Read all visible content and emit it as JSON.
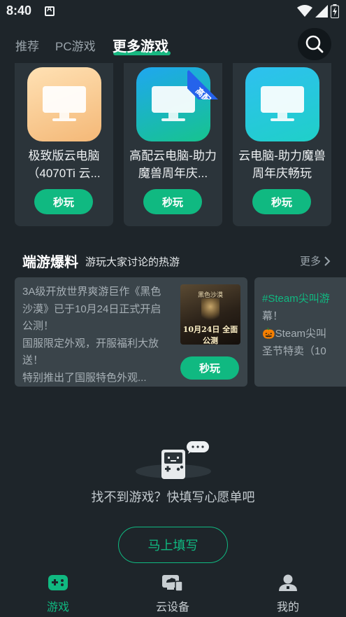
{
  "status_bar": {
    "time": "8:40",
    "icons": [
      "notification-a-icon",
      "wifi-icon",
      "signal-icon",
      "battery-icon"
    ]
  },
  "top_tabs": {
    "items": [
      {
        "label": "推荐",
        "active": false
      },
      {
        "label": "PC游戏",
        "active": false
      },
      {
        "label": "更多游戏",
        "active": true
      }
    ],
    "search_icon": "search-icon"
  },
  "pc_cards": [
    {
      "title": "极致版云电脑（4070Ti 云...",
      "button": "秒玩",
      "icon_color": "#f5c790",
      "badge": ""
    },
    {
      "title": "高配云电脑-助力魔兽周年庆...",
      "button": "秒玩",
      "icon_color": "#16c48e",
      "badge": "高配"
    },
    {
      "title": "云电脑-助力魔兽周年庆畅玩",
      "button": "秒玩",
      "icon_color": "#1fd0c8",
      "badge": ""
    }
  ],
  "section": {
    "title": "端游爆料",
    "subtitle": "游玩大家讨论的热游",
    "more": "更多"
  },
  "news": [
    {
      "text": "3A级开放世界爽游巨作《黑色沙漠》已于10月24日正式开启公测！\n国服限定外观，开服福利大放送！\n特别推出了国服特色外观...",
      "thumb_title": "黑色沙漠",
      "thumb_date": "10月24日 全面公测",
      "button": "秒玩"
    },
    {
      "hashtag": "#Steam尖叫游",
      "text": "幕！\n🎃Steam尖叫\n圣节特卖（10"
    }
  ],
  "wishlist": {
    "message": "找不到游戏？快填写心愿单吧",
    "button": "马上填写"
  },
  "bottom_nav": [
    {
      "label": "游戏",
      "icon": "gamepad-icon",
      "active": true
    },
    {
      "label": "云设备",
      "icon": "cloud-device-icon",
      "active": false
    },
    {
      "label": "我的",
      "icon": "profile-icon",
      "active": false
    }
  ],
  "colors": {
    "accent": "#10b981",
    "background": "#1e252a",
    "card": "#2b343a",
    "badge": "#2563eb"
  }
}
